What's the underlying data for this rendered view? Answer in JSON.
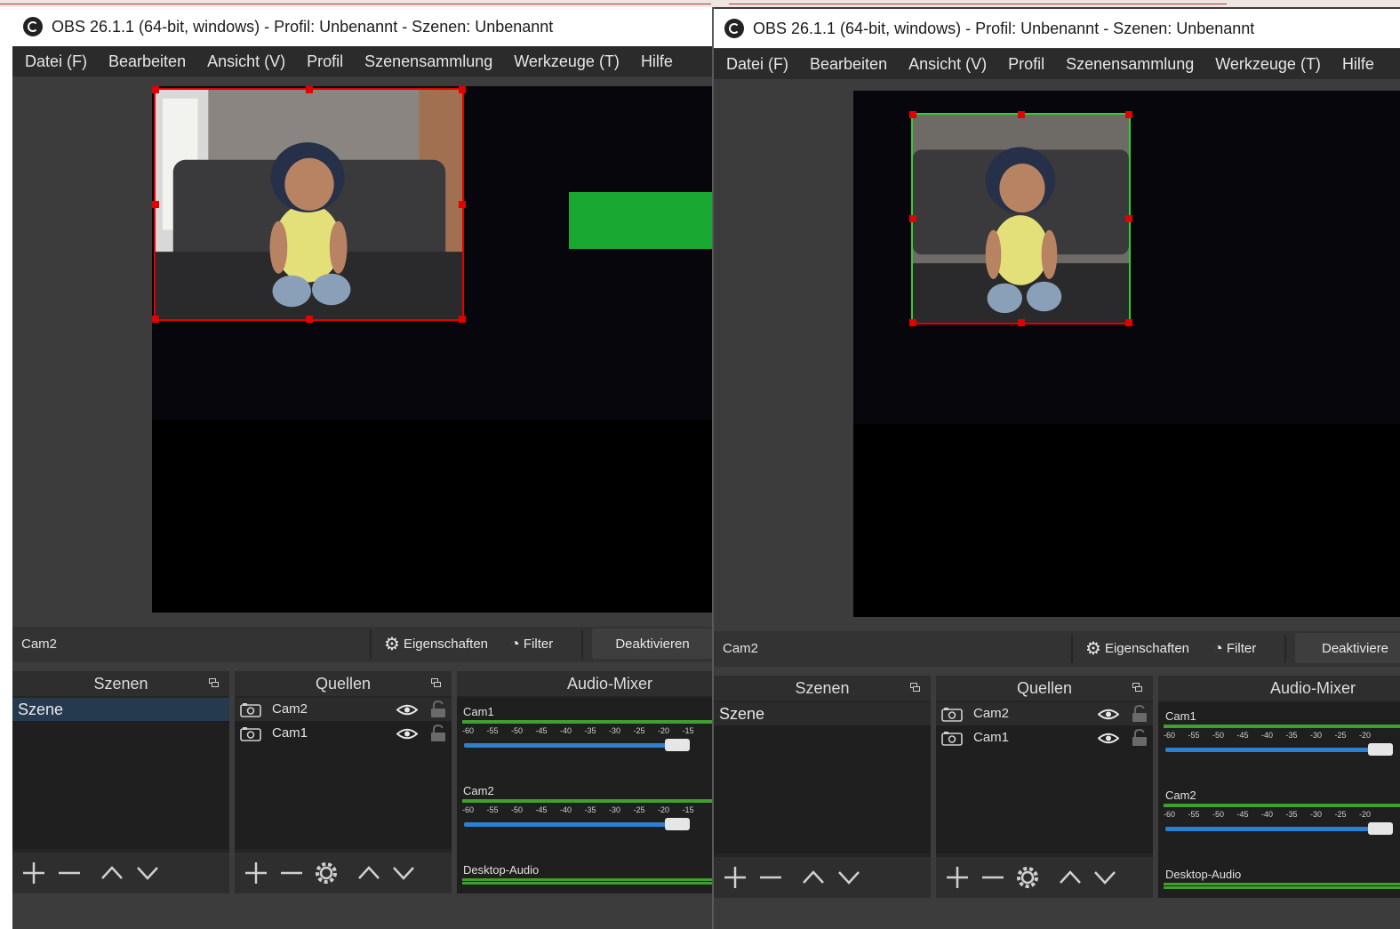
{
  "left": {
    "title": "OBS 26.1.1 (64-bit, windows) - Profil: Unbenannt - Szenen: Unbenannt",
    "menu": [
      "Datei (F)",
      "Bearbeiten",
      "Ansicht (V)",
      "Profil",
      "Szenensammlung",
      "Werkzeuge (T)",
      "Hilfe"
    ],
    "selected_source": "Cam2",
    "selection_color": "#e30000",
    "properties_label": "Eigenschaften",
    "filter_label": "Filter",
    "deactivate_label": "Deaktivieren",
    "scenes": {
      "title": "Szenen",
      "items": [
        "Szene"
      ]
    },
    "sources": {
      "title": "Quellen",
      "items": [
        "Cam2",
        "Cam1"
      ]
    },
    "mixer": {
      "title": "Audio-Mixer",
      "channels": [
        "Cam1",
        "Cam2",
        "Desktop-Audio"
      ],
      "ticks": [
        "-60",
        "-55",
        "-50",
        "-45",
        "-40",
        "-35",
        "-30",
        "-25",
        "-20",
        "-15"
      ]
    }
  },
  "right": {
    "title": "OBS 26.1.1 (64-bit, windows) - Profil: Unbenannt - Szenen: Unbenannt",
    "menu": [
      "Datei (F)",
      "Bearbeiten",
      "Ansicht (V)",
      "Profil",
      "Szenensammlung",
      "Werkzeuge (T)",
      "Hilfe"
    ],
    "selected_source": "Cam2",
    "selection_color": "#2fd12f",
    "properties_label": "Eigenschaften",
    "filter_label": "Filter",
    "deactivate_label": "Deaktiviere",
    "scenes": {
      "title": "Szenen",
      "items": [
        "Szene"
      ]
    },
    "sources": {
      "title": "Quellen",
      "items": [
        "Cam2",
        "Cam1"
      ]
    },
    "mixer": {
      "title": "Audio-Mixer",
      "channels": [
        "Cam1",
        "Cam2",
        "Desktop-Audio"
      ],
      "ticks": [
        "-60",
        "-55",
        "-50",
        "-45",
        "-40",
        "-35",
        "-30",
        "-25",
        "-20"
      ]
    }
  },
  "arrow_color": "#19a832"
}
